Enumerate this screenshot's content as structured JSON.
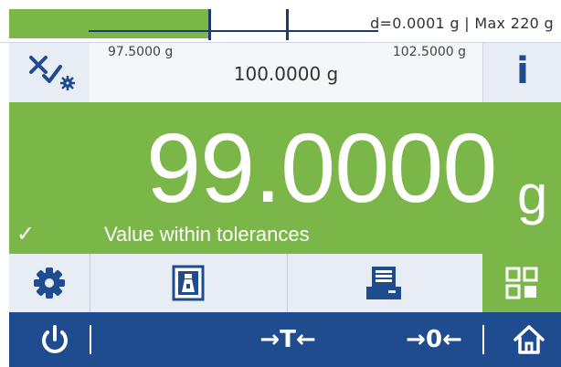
{
  "status_bar": {
    "readability_and_capacity": "d=0.0001 g | Max 220 g"
  },
  "tolerance": {
    "lower_limit": "97.5000 g",
    "target": "100.0000 g",
    "upper_limit": "102.5000 g"
  },
  "result": {
    "weight_value": "99.0000",
    "unit": "g",
    "status_text": "Value within tolerances"
  },
  "icons": {
    "tolerance_settings": "tolerance-settings-icon",
    "info": "info-icon",
    "check": "check-icon",
    "settings": "gear-icon",
    "weight_method": "weight-icon",
    "print": "printer-icon",
    "apps": "grid-icon",
    "power": "power-icon",
    "home": "home-icon"
  },
  "labels": {
    "info_glyph": "i",
    "tare": "→T←",
    "zero": "→0←"
  },
  "colors": {
    "accent_green": "#7ab648",
    "nav_blue": "#1f4b8f",
    "panel_gray": "#e7ecf5"
  }
}
